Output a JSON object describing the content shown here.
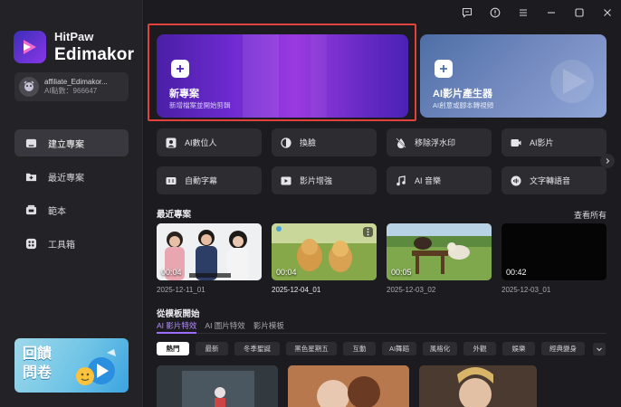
{
  "brand": {
    "top": "HitPaw",
    "bottom": "Edimakor"
  },
  "account": {
    "name": "affiliate_Edimakor...",
    "points": "AI點數：966647"
  },
  "nav": [
    {
      "label": "建立專案",
      "icon": "create-project-icon",
      "active": true
    },
    {
      "label": "最近專案",
      "icon": "recent-folder-icon",
      "active": false
    },
    {
      "label": "範本",
      "icon": "template-icon",
      "active": false
    },
    {
      "label": "工具箱",
      "icon": "toolbox-icon",
      "active": false
    }
  ],
  "promo": {
    "line1": "回饋",
    "line2": "問卷"
  },
  "titlebar": [
    "feedback-icon",
    "update-icon",
    "menu-icon",
    "minimize-icon",
    "maximize-icon",
    "close-icon"
  ],
  "hero": {
    "new_project": {
      "title": "新專案",
      "subtitle": "新增檔案並開始剪輯"
    },
    "ai_video": {
      "title": "AI影片產生器",
      "subtitle": "AI創意或腳本轉視頻"
    }
  },
  "tools": [
    {
      "label": "AI數位人",
      "icon": "digital-human-icon"
    },
    {
      "label": "換臉",
      "icon": "face-swap-icon"
    },
    {
      "label": "移除浮水印",
      "icon": "remove-watermark-icon"
    },
    {
      "label": "AI影片",
      "icon": "ai-video-icon"
    },
    {
      "label": "自動字幕",
      "icon": "auto-subtitle-icon"
    },
    {
      "label": "影片增強",
      "icon": "video-enhance-icon"
    },
    {
      "label": "AI 音樂",
      "icon": "ai-music-icon"
    },
    {
      "label": "文字轉語音",
      "icon": "text-to-speech-icon"
    }
  ],
  "recent": {
    "title": "最近專案",
    "view_all": "查看所有",
    "items": [
      {
        "duration": "00:04",
        "name": "2025-12-11_01"
      },
      {
        "duration": "00:04",
        "name": "2025-12-04_01"
      },
      {
        "duration": "00:05",
        "name": "2025-12-03_02"
      },
      {
        "duration": "00:42",
        "name": "2025-12-03_01"
      }
    ]
  },
  "templates": {
    "title": "從模板開始",
    "tabs": [
      "AI 影片特效",
      "AI 圖片特效",
      "影片模板"
    ],
    "chips": [
      "熱門",
      "最新",
      "冬季聖誕",
      "黑色星期五",
      "互動",
      "AI舞蹈",
      "風格化",
      "外觀",
      "娛樂",
      "經典變身"
    ]
  }
}
